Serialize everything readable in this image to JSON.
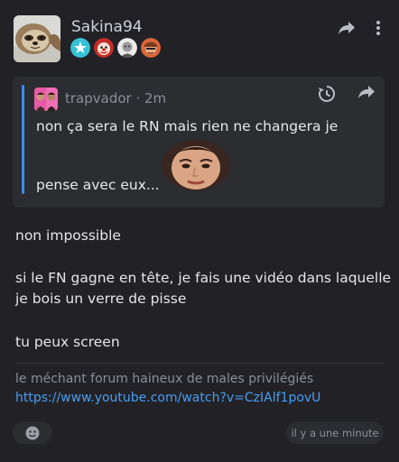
{
  "post": {
    "author": "Sakina94",
    "avatar_icon": "sloth-avatar-icon",
    "badges": [
      "star-badge-icon",
      "clown-badge-icon",
      "face-badge-icon",
      "face-badge-icon-2"
    ],
    "actions": [
      "share-icon",
      "more-icon"
    ]
  },
  "quote": {
    "author_line": "trapvador · 2m",
    "avatar_icon": "quote-avatar-icon",
    "line1": "non ça sera le RN mais rien ne changera je",
    "line2": "pense avec eux...",
    "emote_icon": "face-emote-icon",
    "actions": [
      "history-icon",
      "share-icon"
    ]
  },
  "body": {
    "p1": "non impossible",
    "p2a": "si le FN gagne en tête, je fais une vidéo dans laquelle",
    "p2b": "je bois un verre de pisse",
    "p3": "tu peux screen"
  },
  "signature": {
    "text": "le méchant forum haineux de males privilégiés",
    "link": "https://www.youtube.com/watch?v=CzIAlf1povU"
  },
  "footer": {
    "reaction_icon": "emoji-react-icon",
    "time": "il y a une minute"
  },
  "colors": {
    "accent": "#3d8cf0",
    "link": "#4a9cf0",
    "background": "#222226"
  }
}
